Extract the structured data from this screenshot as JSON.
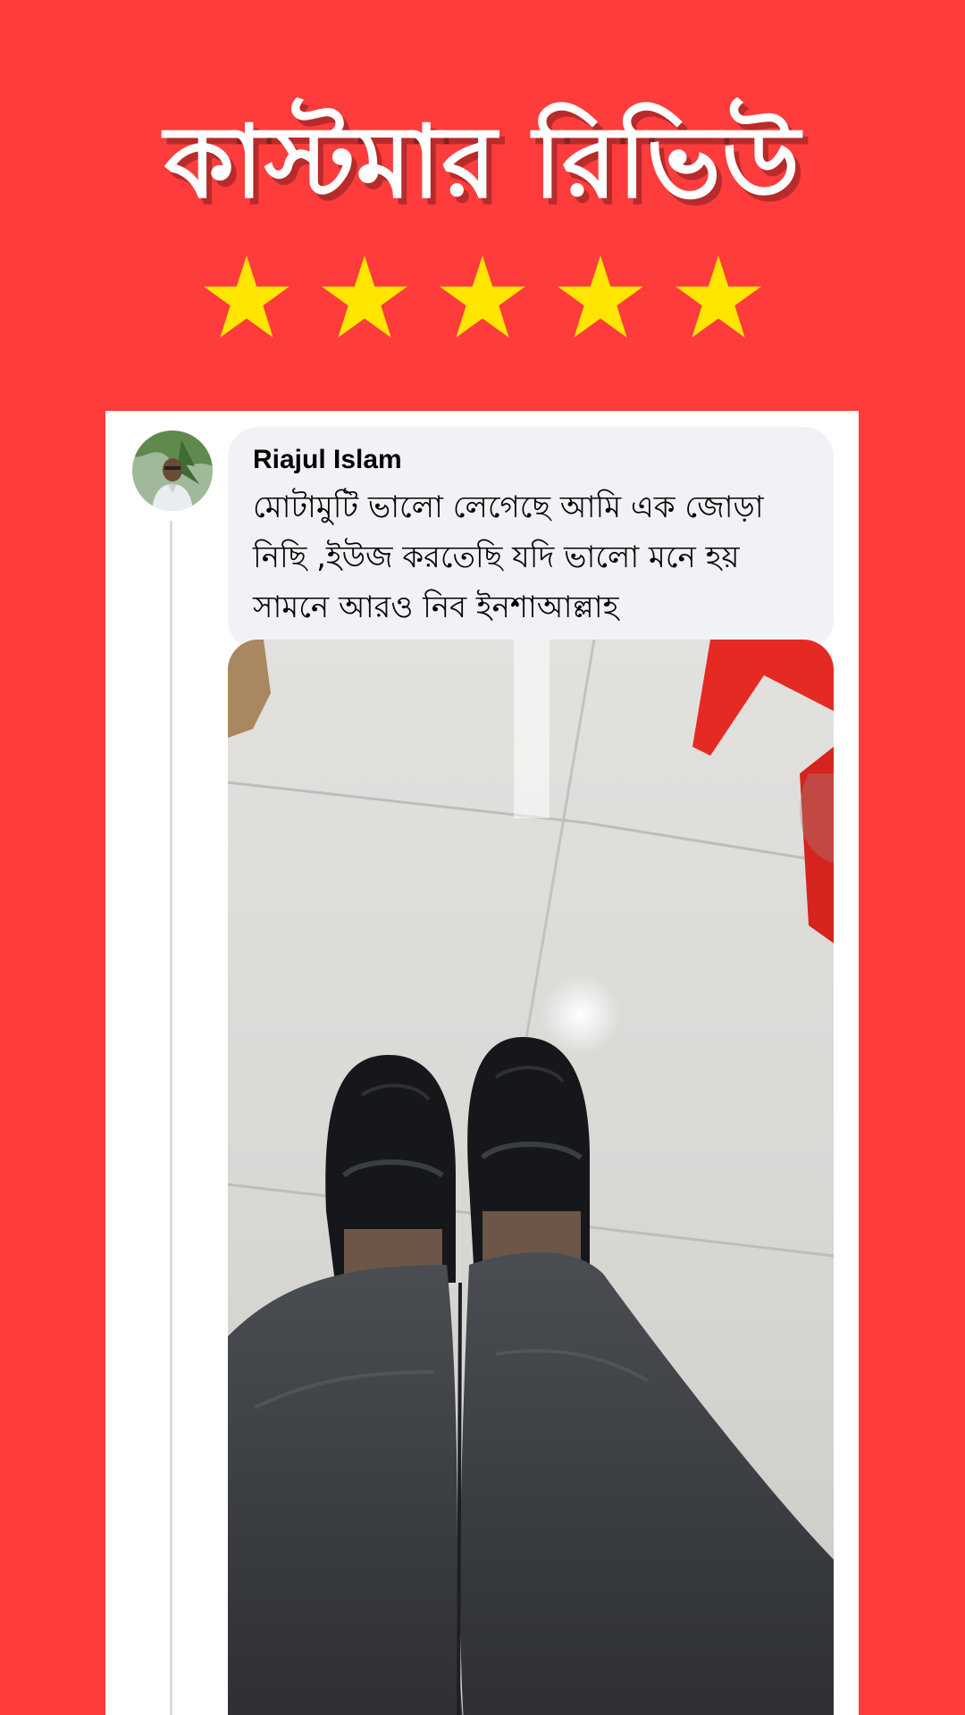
{
  "header": {
    "title": "কাস্টমার রিভিউ"
  },
  "rating": {
    "stars": 5,
    "max": 5,
    "color": "#ffe500"
  },
  "review": {
    "author": "Riajul Islam",
    "comment": "মোটামুটি ভালো লেগেছে আমি এক জোড়া নিছি ,ইউজ করতেছি যদি ভালো মনে হয় সামনে আরও নিব ইনশাআল্লাহ",
    "avatar_icon": "avatar-photo",
    "photo_icon": "review-photo-black-loafers"
  },
  "colors": {
    "background": "#fe3c3c",
    "card": "#ffffff",
    "bubble": "#f0f2f5"
  }
}
